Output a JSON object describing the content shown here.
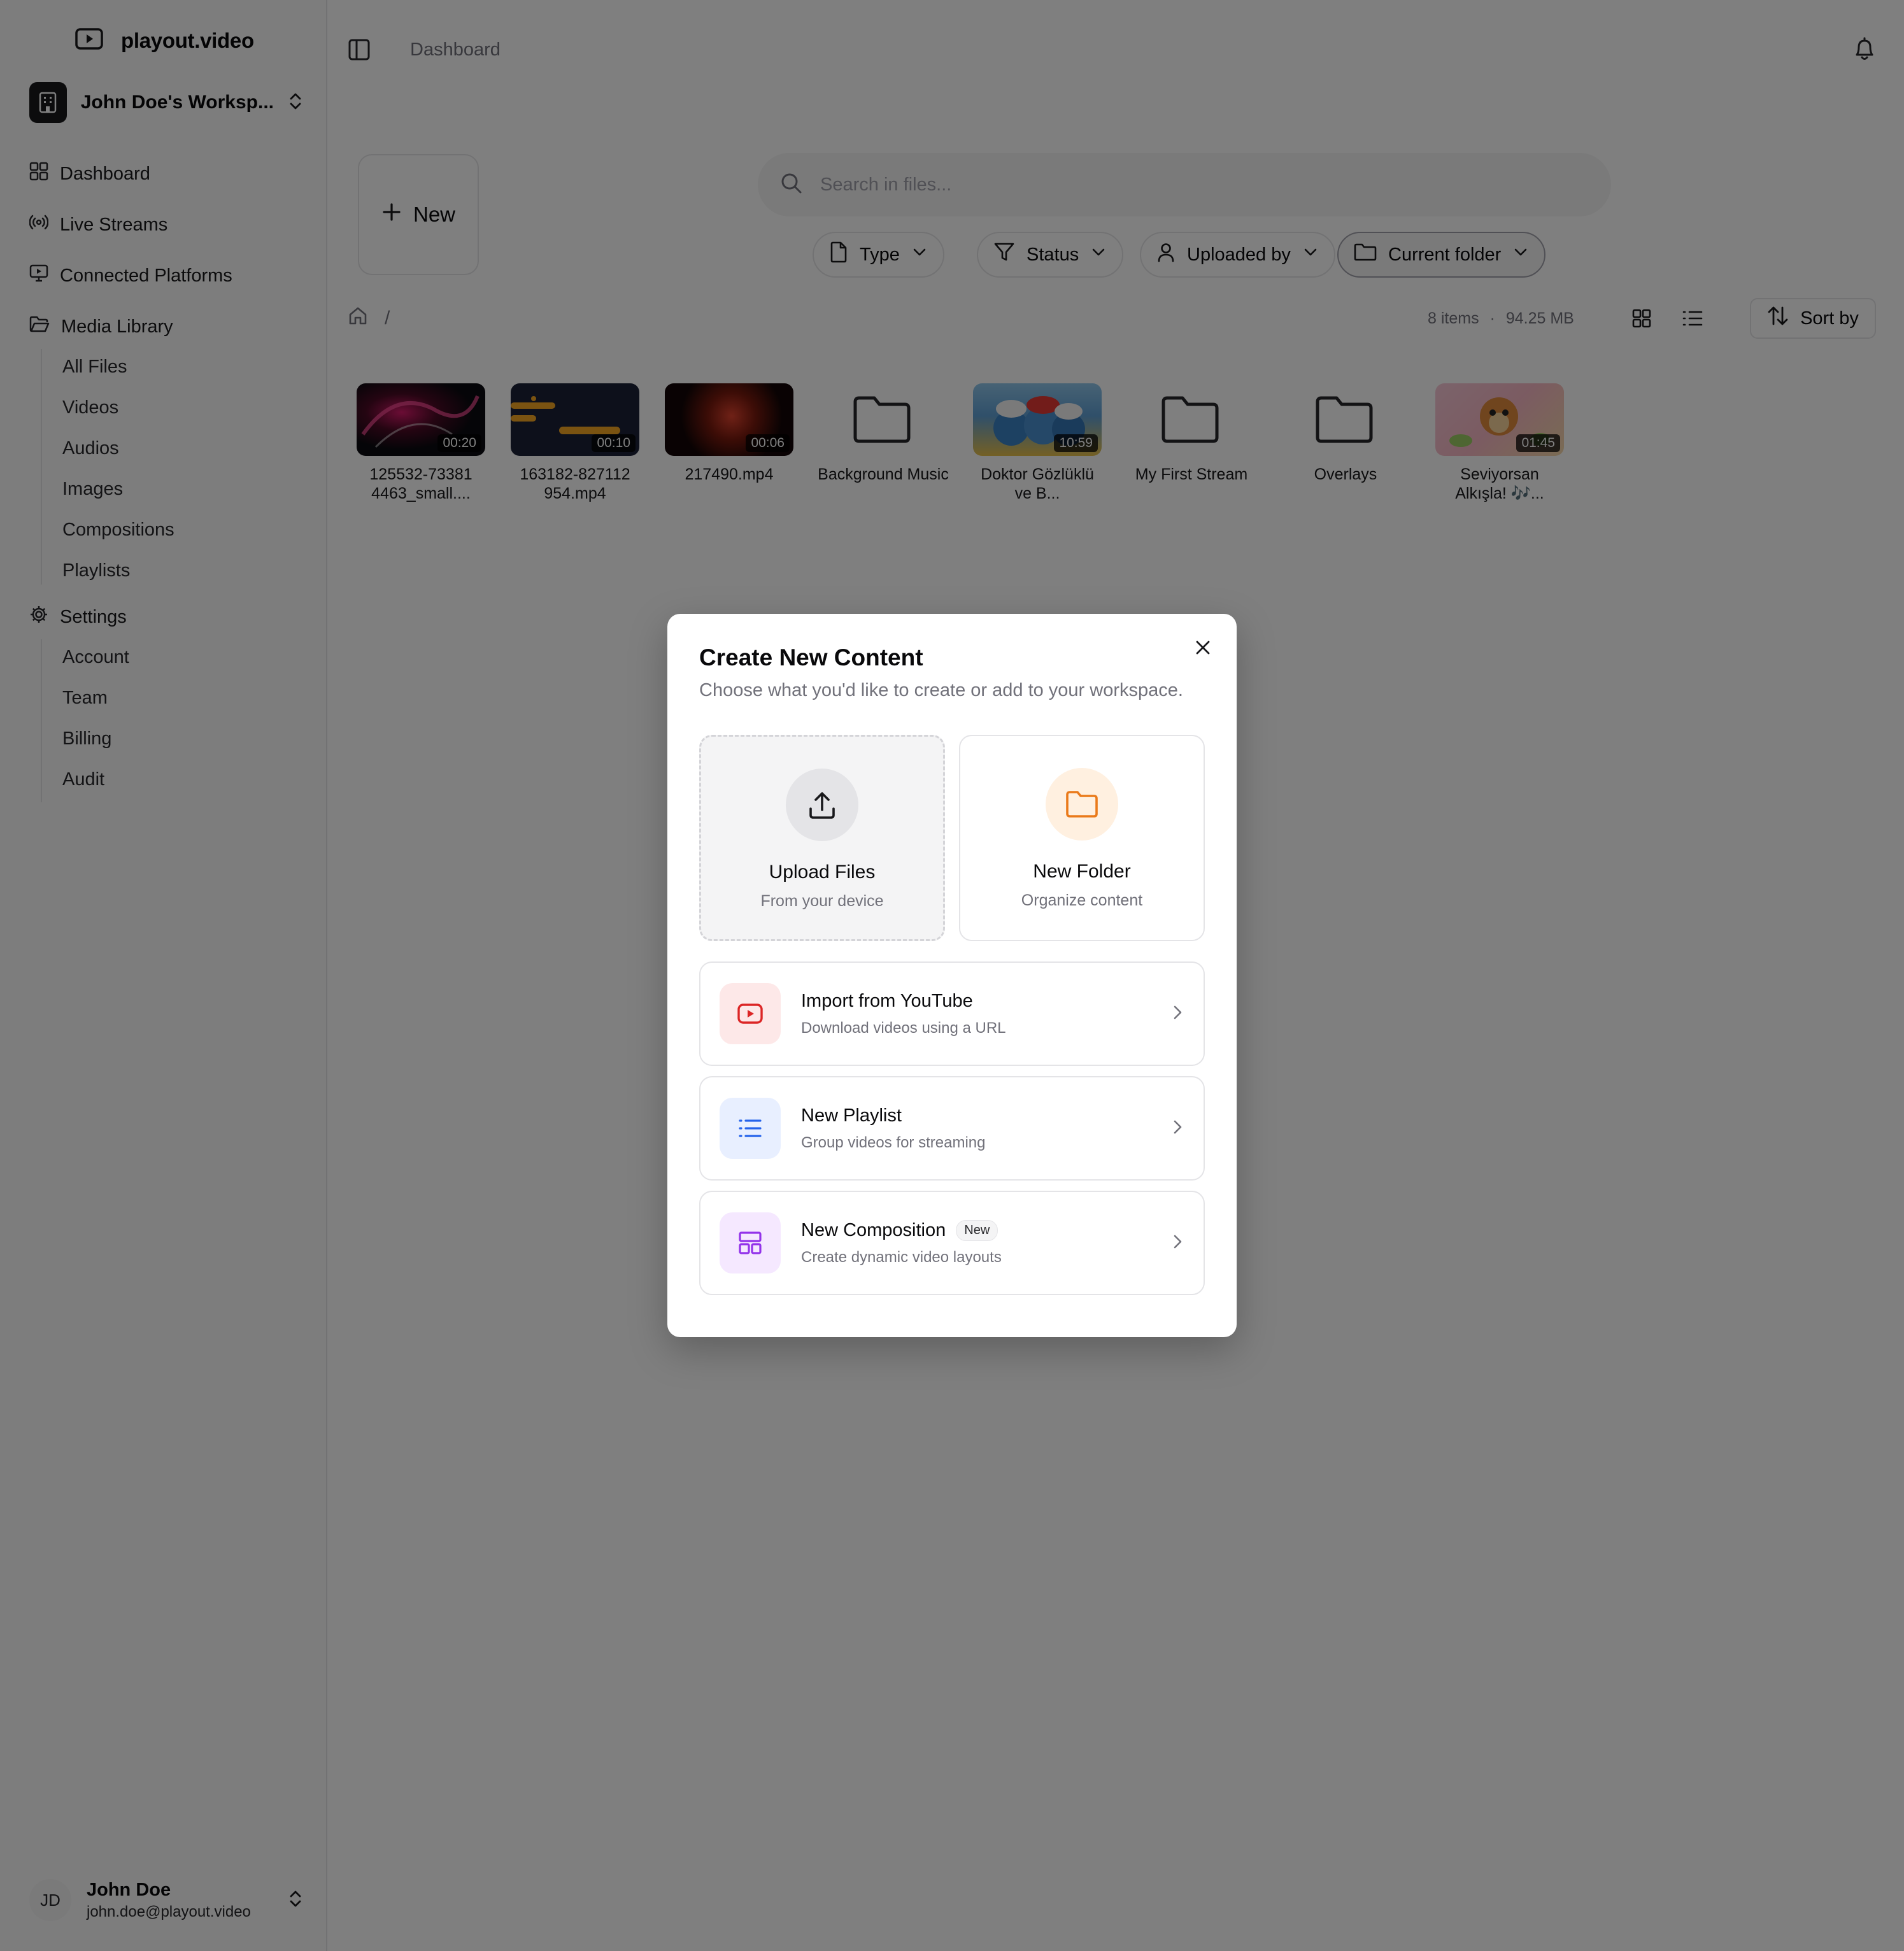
{
  "brand": {
    "name": "playout.video"
  },
  "workspace": {
    "name": "John Doe's Worksp..."
  },
  "sidebar": {
    "nav": {
      "dashboard": "Dashboard",
      "live_streams": "Live Streams",
      "connected_platforms": "Connected Platforms",
      "media_library": "Media Library",
      "settings": "Settings"
    },
    "media_items": [
      "All Files",
      "Videos",
      "Audios",
      "Images",
      "Compositions",
      "Playlists"
    ],
    "settings_items": [
      "Account",
      "Team",
      "Billing",
      "Audit"
    ]
  },
  "user": {
    "initials": "JD",
    "name": "John Doe",
    "email": "john.doe@playout.video"
  },
  "topbar": {
    "title": "Dashboard"
  },
  "toolbar": {
    "new_label": "New",
    "search_placeholder": "Search in files...",
    "filters": {
      "type": "Type",
      "status": "Status",
      "uploaded_by": "Uploaded by",
      "current_folder": "Current folder"
    }
  },
  "breadcrumb": {
    "separator": "/"
  },
  "listing": {
    "items_count": "8 items",
    "dot": "·",
    "total_size": "94.25 MB",
    "sort_label": "Sort by"
  },
  "files": [
    {
      "kind": "video",
      "name": "125532-73381 4463_small....",
      "duration": "00:20"
    },
    {
      "kind": "video",
      "name": "163182-827112 954.mp4",
      "duration": "00:10"
    },
    {
      "kind": "video",
      "name": "217490.mp4",
      "duration": "00:06"
    },
    {
      "kind": "folder",
      "name": "Background Music"
    },
    {
      "kind": "video",
      "name": "Doktor Gözlüklü ve B...",
      "duration": "10:59"
    },
    {
      "kind": "folder",
      "name": "My First Stream"
    },
    {
      "kind": "folder",
      "name": "Overlays"
    },
    {
      "kind": "video",
      "name": "Seviyorsan Alkışla! 🎶...",
      "duration": "01:45"
    }
  ],
  "dialog": {
    "title": "Create New Content",
    "subtitle": "Choose what you'd like to create or add to your workspace.",
    "upload": {
      "title": "Upload Files",
      "subtitle": "From your device"
    },
    "folder": {
      "title": "New Folder",
      "subtitle": "Organize content"
    },
    "youtube": {
      "title": "Import from YouTube",
      "subtitle": "Download videos using a URL"
    },
    "playlist": {
      "title": "New Playlist",
      "subtitle": "Group videos for streaming"
    },
    "composition": {
      "title": "New Composition",
      "badge": "New",
      "subtitle": "Create dynamic video layouts"
    }
  },
  "colors": {
    "accent_orange": "#ea7a1a",
    "youtube_red": "#dc2626",
    "playlist_blue": "#2563eb",
    "composition_purple": "#9333ea"
  }
}
